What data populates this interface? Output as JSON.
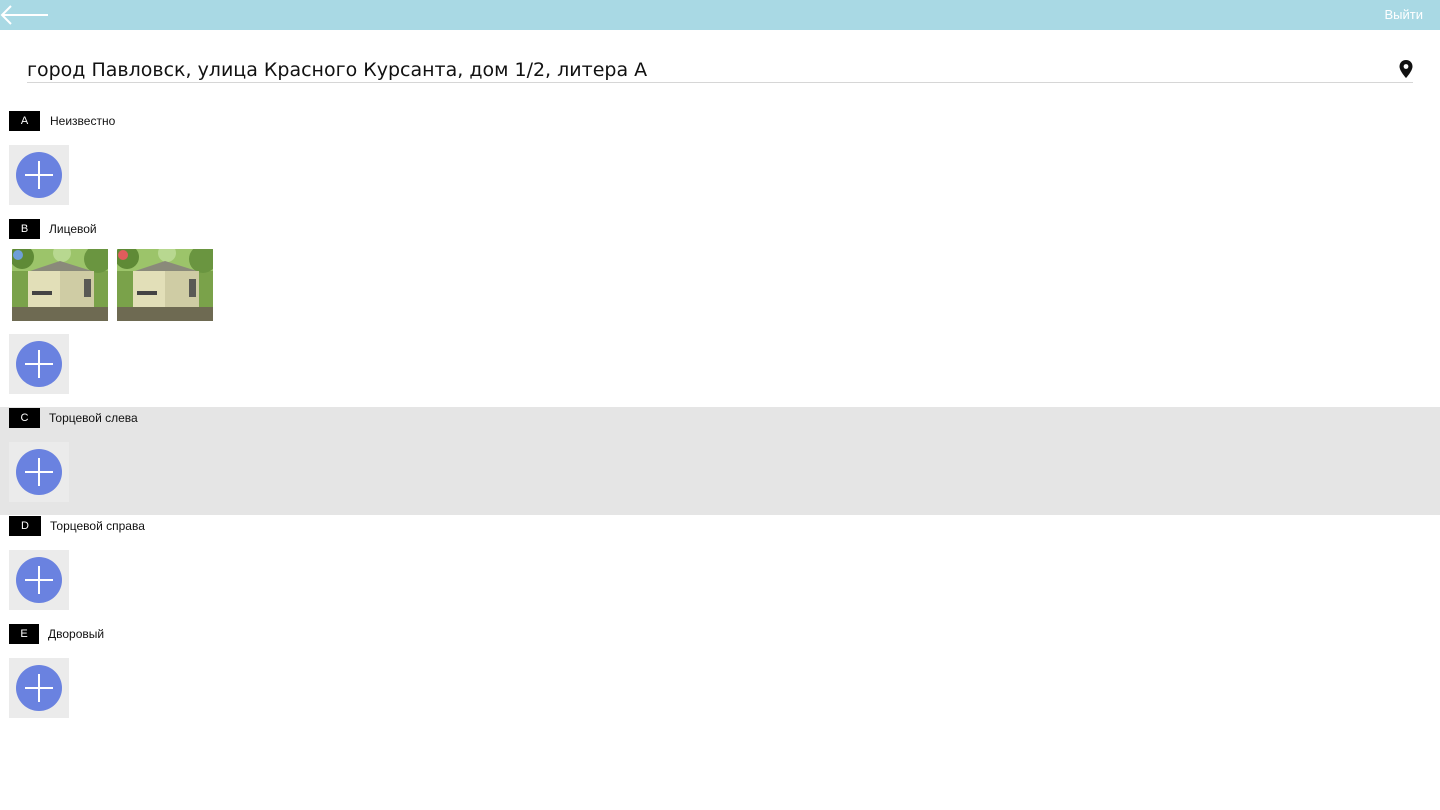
{
  "topbar": {
    "back_icon": "arrow-left-icon",
    "logout_label": "Выйти",
    "background": "#a9d9e4"
  },
  "address": {
    "text": "город Павловск, улица Красного Курсанта, дом 1/2, литера А",
    "pin_icon": "map-pin-icon"
  },
  "sections": [
    {
      "letter": "A",
      "label": "Неизвестно",
      "photos": []
    },
    {
      "letter": "B",
      "label": "Лицевой",
      "photos": [
        {
          "status_color": "#6f9fd8"
        },
        {
          "status_color": "#e05c5c"
        }
      ]
    },
    {
      "letter": "C",
      "label": "Торцевой слева",
      "highlighted": true,
      "photos": []
    },
    {
      "letter": "D",
      "label": "Торцевой справа",
      "photos": []
    },
    {
      "letter": "E",
      "label": "Дворовый",
      "photos": []
    }
  ],
  "add_button": {
    "icon": "plus-icon",
    "color": "#6a82e0"
  }
}
